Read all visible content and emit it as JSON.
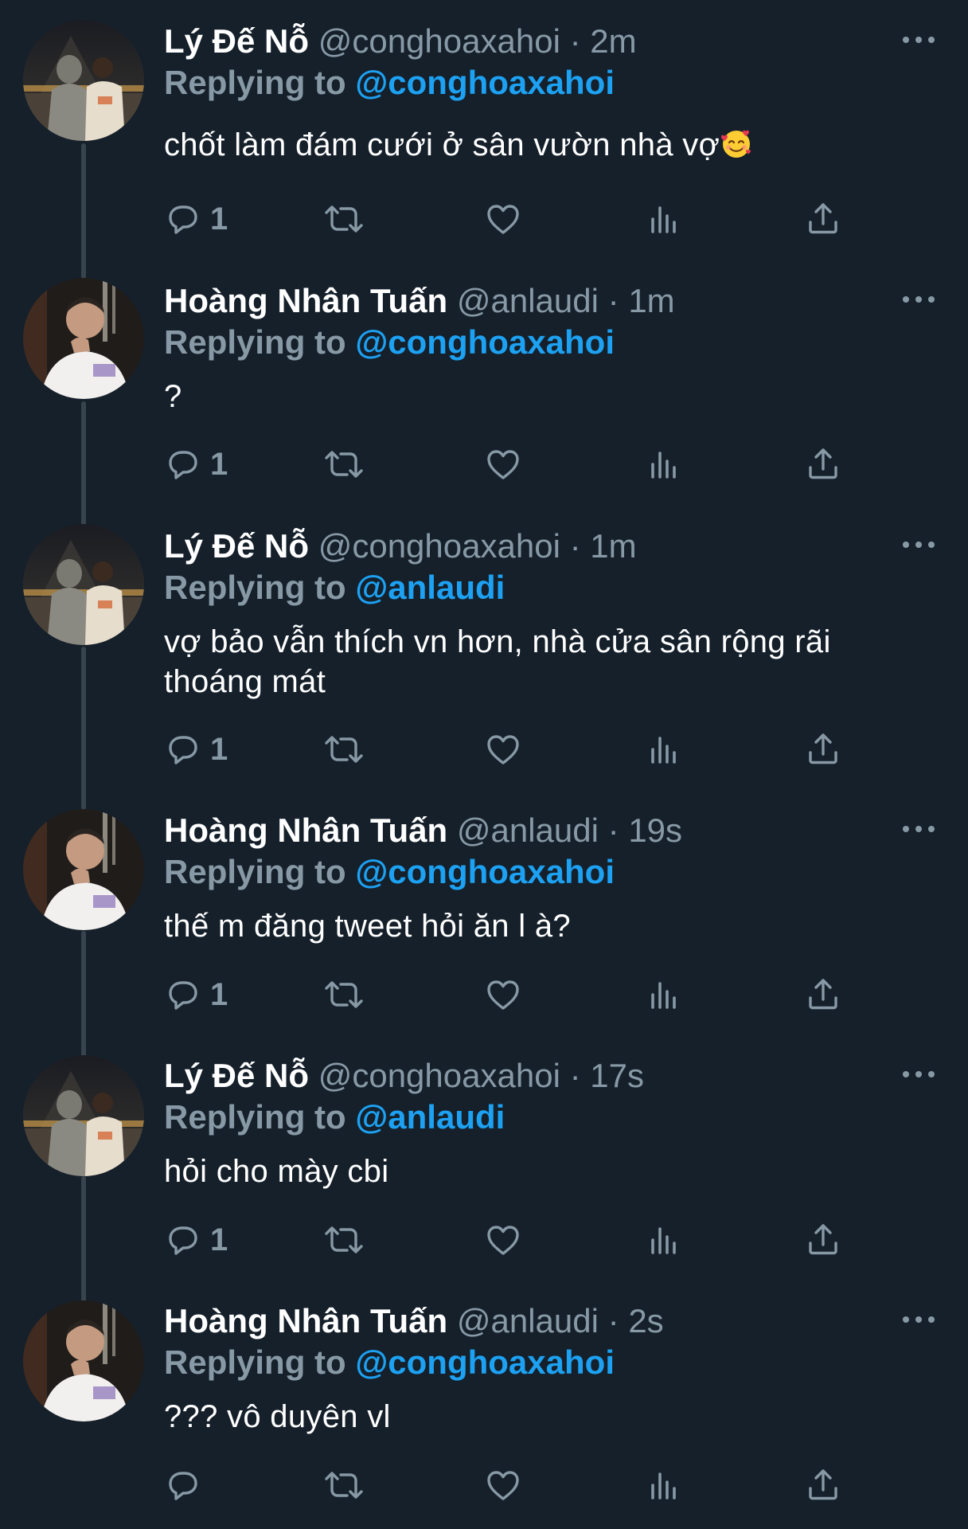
{
  "users": {
    "ly": {
      "name": "Lý Đế Nỗ",
      "handle": "@conghoaxahoi"
    },
    "hoang": {
      "name": "Hoàng Nhân Tuấn",
      "handle": "@anlaudi"
    }
  },
  "reply_label": "Replying to",
  "dot": "·",
  "colors": {
    "background": "#15202b",
    "secondary_text": "#8899a6",
    "link": "#1da1f2",
    "thread_line": "#38444d"
  },
  "icons": [
    "reply-icon",
    "retweet-icon",
    "like-icon",
    "analytics-icon",
    "share-icon",
    "more-options-icon"
  ],
  "tweets": [
    {
      "name": "Lý Đế Nỗ",
      "handle": "@conghoaxahoi",
      "time": "2m",
      "replying_to": "@conghoaxahoi",
      "text": "chốt làm đám cưới ở sân vườn nhà vợ",
      "emoji": "smiling-face-with-hearts",
      "reply_count": "1"
    },
    {
      "name": "Hoàng Nhân Tuấn",
      "handle": "@anlaudi",
      "time": "1m",
      "replying_to": "@conghoaxahoi",
      "text": "?",
      "reply_count": "1"
    },
    {
      "name": "Lý Đế Nỗ",
      "handle": "@conghoaxahoi",
      "time": "1m",
      "replying_to": "@anlaudi",
      "text": "vợ bảo vẫn thích vn hơn, nhà cửa sân rộng rãi thoáng mát",
      "reply_count": "1"
    },
    {
      "name": "Hoàng Nhân Tuấn",
      "handle": "@anlaudi",
      "time": "19s",
      "replying_to": "@conghoaxahoi",
      "text": "thế m đăng tweet hỏi ăn l à?",
      "reply_count": "1"
    },
    {
      "name": "Lý Đế Nỗ",
      "handle": "@conghoaxahoi",
      "time": "17s",
      "replying_to": "@anlaudi",
      "text": "hỏi cho mày cbi",
      "reply_count": "1"
    },
    {
      "name": "Hoàng Nhân Tuấn",
      "handle": "@anlaudi",
      "time": "2s",
      "replying_to": "@conghoaxahoi",
      "text": "??? vô duyên vl",
      "reply_count": ""
    }
  ]
}
